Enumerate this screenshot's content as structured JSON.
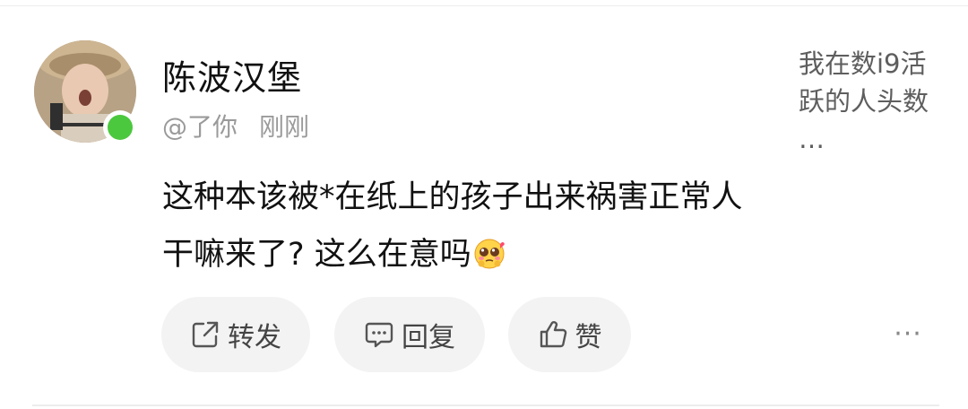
{
  "comment": {
    "username": "陈波汉堡",
    "handle": "@了你",
    "time": "刚刚",
    "side_text": "我在数i9活跃的人头数 …",
    "content": "这种本该被*在纸上的孩子出来祸害正常人干嘛来了? 这么在意吗",
    "emoji_icon": "pleading-face-emoji",
    "online_color": "#4cc83e"
  },
  "actions": {
    "share_label": "转发",
    "reply_label": "回复",
    "like_label": "赞",
    "more_label": "···"
  }
}
